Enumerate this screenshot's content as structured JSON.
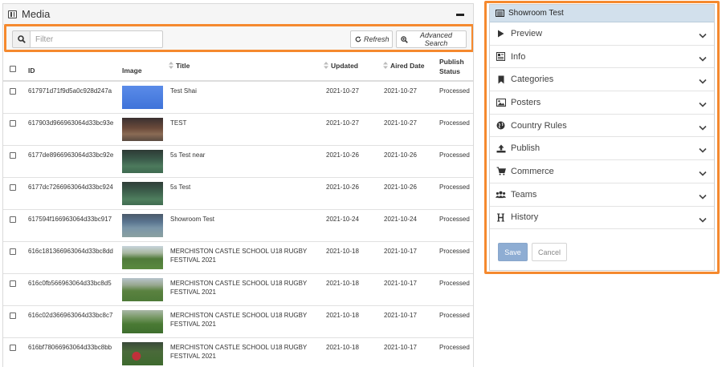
{
  "media": {
    "title": "Media",
    "filter_placeholder": "Filter",
    "refresh_label": "Refresh",
    "advanced_search_label": "Advanced Search",
    "columns": {
      "id": "ID",
      "image": "Image",
      "title": "Title",
      "updated": "Updated",
      "aired_date": "Aired Date",
      "publish_status_1": "Publish",
      "publish_status_2": "Status"
    },
    "rows": [
      {
        "id": "617971d71f9d5a0c928d247a",
        "title": "Test Shai",
        "updated": "2021-10-27",
        "aired": "2021-10-27",
        "status": "Processed"
      },
      {
        "id": "617903d966963064d33bc93e",
        "title": "TEST",
        "updated": "2021-10-27",
        "aired": "2021-10-27",
        "status": "Processed"
      },
      {
        "id": "6177de8966963064d33bc92e",
        "title": "5s Test near",
        "updated": "2021-10-26",
        "aired": "2021-10-26",
        "status": "Processed"
      },
      {
        "id": "6177dc7266963064d33bc924",
        "title": "5s Test",
        "updated": "2021-10-26",
        "aired": "2021-10-26",
        "status": "Processed"
      },
      {
        "id": "617594f166963064d33bc917",
        "title": "Showroom Test",
        "updated": "2021-10-24",
        "aired": "2021-10-24",
        "status": "Processed"
      },
      {
        "id": "616c181366963064d33bc8dd",
        "title": "MERCHISTON CASTLE SCHOOL U18 RUGBY",
        "title2": "FESTIVAL 2021",
        "updated": "2021-10-18",
        "aired": "2021-10-17",
        "status": "Processed"
      },
      {
        "id": "616c0fb566963064d33bc8d5",
        "title": "MERCHISTON CASTLE SCHOOL U18 RUGBY",
        "title2": "FESTIVAL 2021",
        "updated": "2021-10-18",
        "aired": "2021-10-17",
        "status": "Processed"
      },
      {
        "id": "616c02d366963064d33bc8c7",
        "title": "MERCHISTON CASTLE SCHOOL U18 RUGBY",
        "title2": "FESTIVAL 2021",
        "updated": "2021-10-18",
        "aired": "2021-10-17",
        "status": "Processed"
      },
      {
        "id": "616bf78066963064d33bc8bb",
        "title": "MERCHISTON CASTLE SCHOOL U18 RUGBY",
        "title2": "FESTIVAL 2021",
        "updated": "2021-10-18",
        "aired": "2021-10-17",
        "status": "Processed"
      }
    ]
  },
  "details": {
    "title": "Showroom Test",
    "sections": [
      {
        "label": "Preview",
        "icon": "play-icon"
      },
      {
        "label": "Info",
        "icon": "info-icon"
      },
      {
        "label": "Categories",
        "icon": "bookmark-icon"
      },
      {
        "label": "Posters",
        "icon": "image-icon"
      },
      {
        "label": "Country Rules",
        "icon": "globe-icon"
      },
      {
        "label": "Publish",
        "icon": "upload-icon"
      },
      {
        "label": "Commerce",
        "icon": "cart-icon"
      },
      {
        "label": "Teams",
        "icon": "users-icon"
      },
      {
        "label": "History",
        "icon": "history-icon"
      }
    ],
    "save_label": "Save",
    "cancel_label": "Cancel"
  },
  "colors": {
    "highlight": "#f5892e",
    "details_header": "#d2e0ec",
    "save_button": "#8eadd3"
  }
}
